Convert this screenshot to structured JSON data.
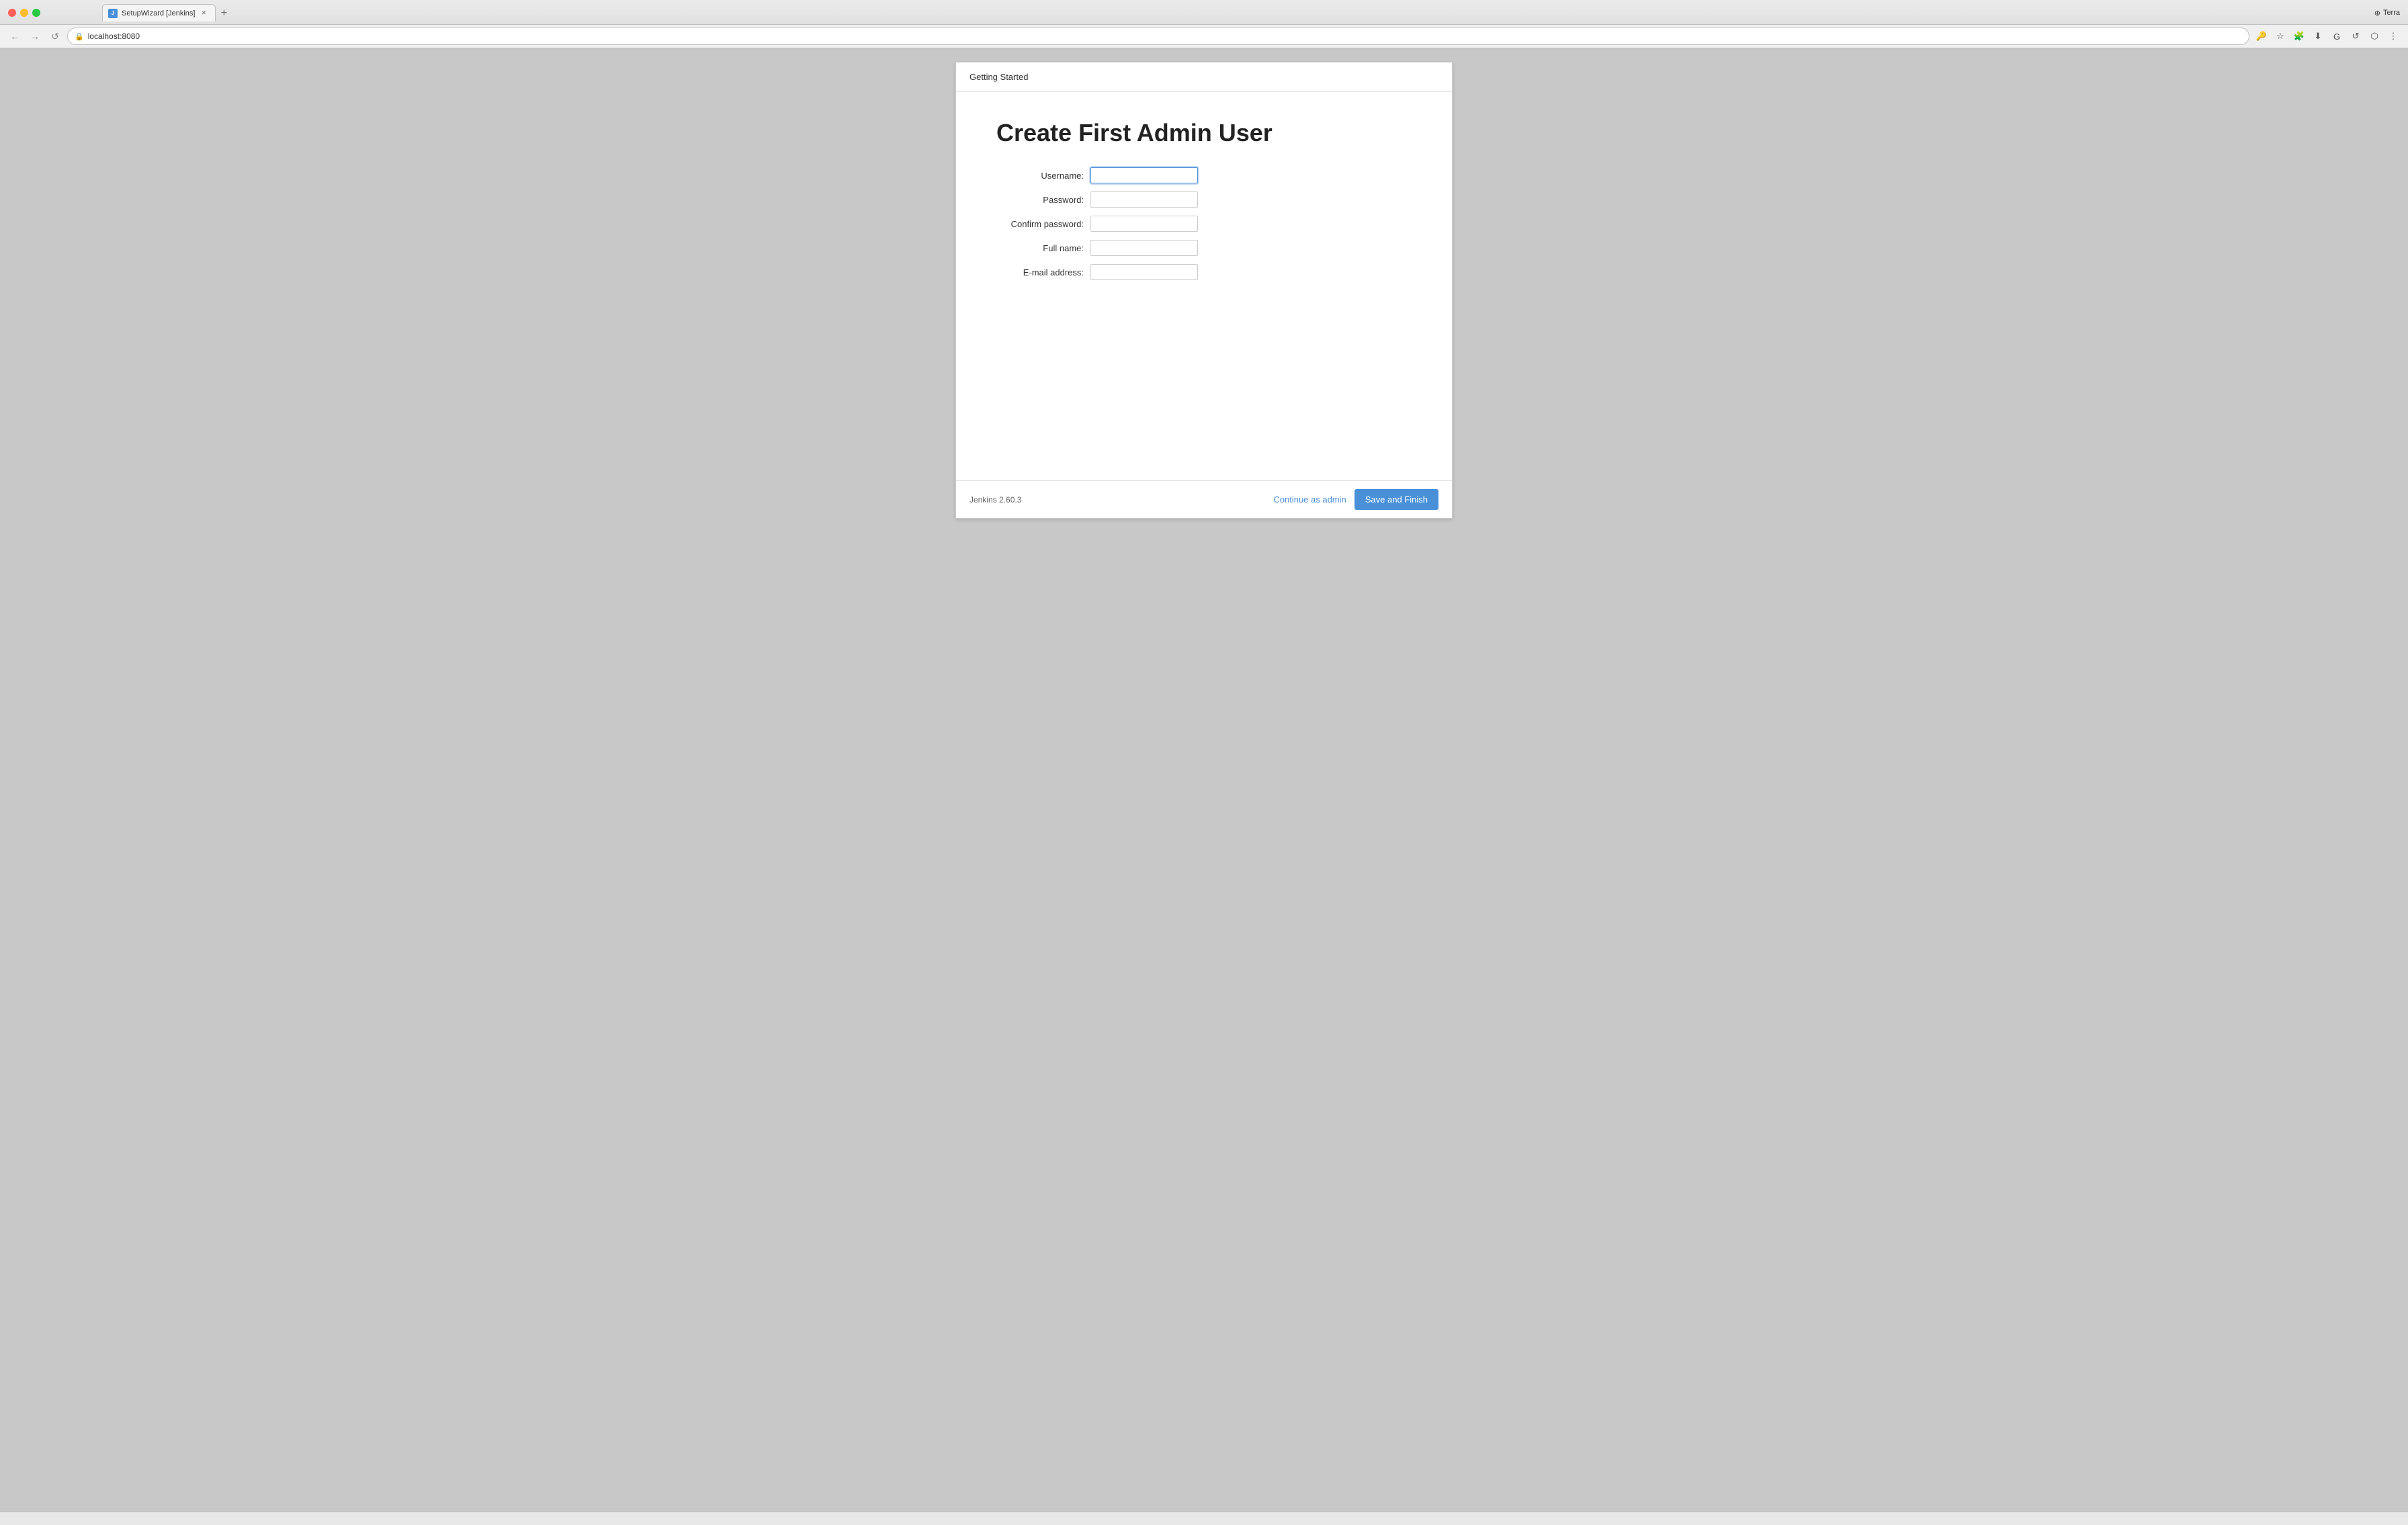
{
  "browser": {
    "tab": {
      "title": "SetupWizard [Jenkins]",
      "favicon_label": "J"
    },
    "new_tab_symbol": "+",
    "address_bar": {
      "url": "localhost:8080",
      "lock_symbol": "🔒"
    },
    "nav": {
      "back_symbol": "←",
      "forward_symbol": "→",
      "reload_symbol": "↺"
    },
    "brand": {
      "label": "Terra",
      "symbol": "⊕"
    },
    "toolbar_icons": [
      "🔑",
      "☆",
      "🔔",
      "⬛",
      "📷",
      "G",
      "↺",
      "⬛",
      "⋮"
    ]
  },
  "panel": {
    "header": {
      "title": "Getting Started"
    },
    "body": {
      "heading": "Create First Admin User"
    },
    "form": {
      "fields": [
        {
          "label": "Username:",
          "type": "text",
          "focused": true
        },
        {
          "label": "Password:",
          "type": "password",
          "focused": false
        },
        {
          "label": "Confirm password:",
          "type": "password",
          "focused": false
        },
        {
          "label": "Full name:",
          "type": "text",
          "focused": false
        },
        {
          "label": "E-mail address:",
          "type": "email",
          "focused": false
        }
      ]
    },
    "footer": {
      "version": "Jenkins 2.60.3",
      "continue_label": "Continue as admin",
      "save_label": "Save and Finish"
    }
  }
}
